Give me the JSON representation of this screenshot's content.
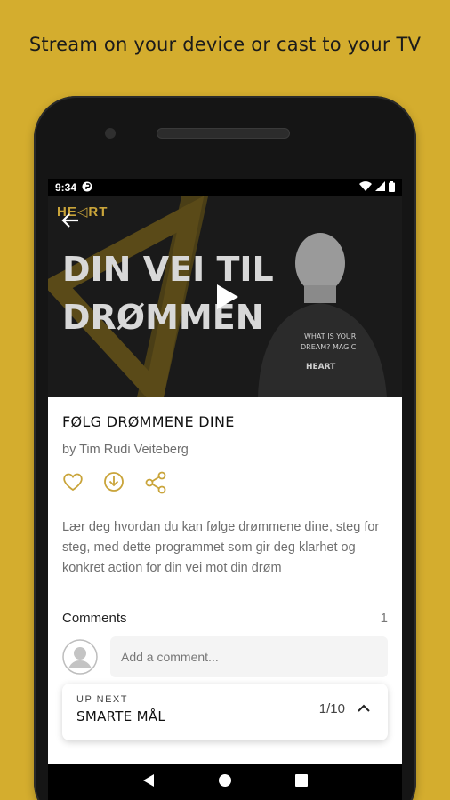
{
  "promo": {
    "headline": "Stream on your device or cast to your TV"
  },
  "status_bar": {
    "time": "9:34"
  },
  "hero": {
    "logo": "HE◁RT",
    "title_line1": "DIN VEI TIL",
    "title_line2": "DRØMMEN"
  },
  "program": {
    "title": "FØLG DRØMMENE DINE",
    "author": "by Tim Rudi Veiteberg",
    "description": "Lær deg hvordan du kan følge drømmene dine, steg for steg, med dette programmet som gir deg klarhet og konkret action for din vei mot din drøm"
  },
  "actions": {
    "icons": [
      "heart-icon",
      "download-icon",
      "share-icon"
    ]
  },
  "comments": {
    "label": "Comments",
    "count": "1",
    "placeholder": "Add a comment..."
  },
  "up_next": {
    "label": "UP NEXT",
    "title": "SMARTE MÅL",
    "position": "1/10"
  },
  "colors": {
    "background": "#D4AD2E",
    "accent": "#C9A43A"
  }
}
